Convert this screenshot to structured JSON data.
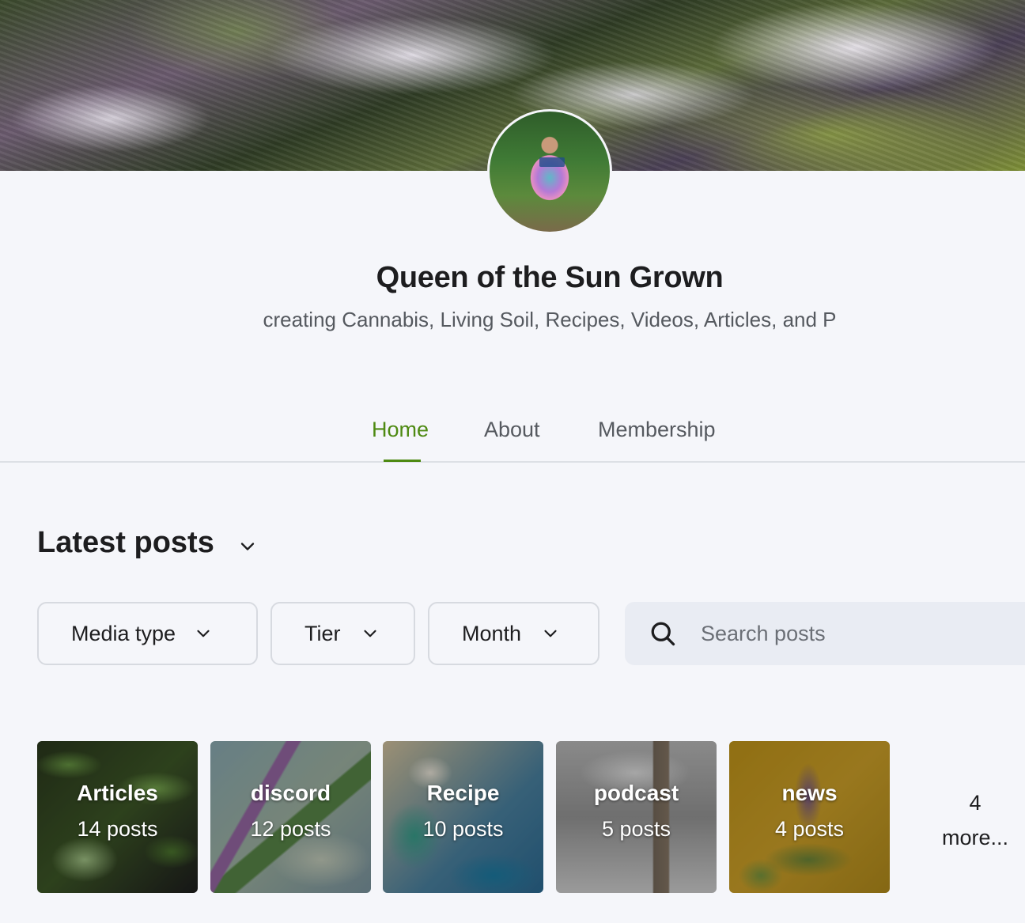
{
  "creator": {
    "name": "Queen of the Sun Grown",
    "tagline": "creating Cannabis, Living Soil, Recipes, Videos, Articles, and P"
  },
  "nav": {
    "tabs": [
      {
        "label": "Home",
        "active": true
      },
      {
        "label": "About",
        "active": false
      },
      {
        "label": "Membership",
        "active": false
      }
    ]
  },
  "posts_section": {
    "title": "Latest posts",
    "filters": [
      {
        "label": "Media type"
      },
      {
        "label": "Tier"
      },
      {
        "label": "Month"
      }
    ],
    "search": {
      "placeholder": "Search posts",
      "value": ""
    }
  },
  "collections": {
    "items": [
      {
        "name": "Articles",
        "count": "14 posts"
      },
      {
        "name": "discord",
        "count": "12 posts"
      },
      {
        "name": "Recipe",
        "count": "10 posts"
      },
      {
        "name": "podcast",
        "count": "5 posts"
      },
      {
        "name": "news",
        "count": "4 posts"
      }
    ],
    "more": {
      "count": "4",
      "label": "more..."
    }
  },
  "colors": {
    "accent": "#4e8a12",
    "background": "#f5f6fa",
    "search_bg": "#e9ecf3"
  }
}
